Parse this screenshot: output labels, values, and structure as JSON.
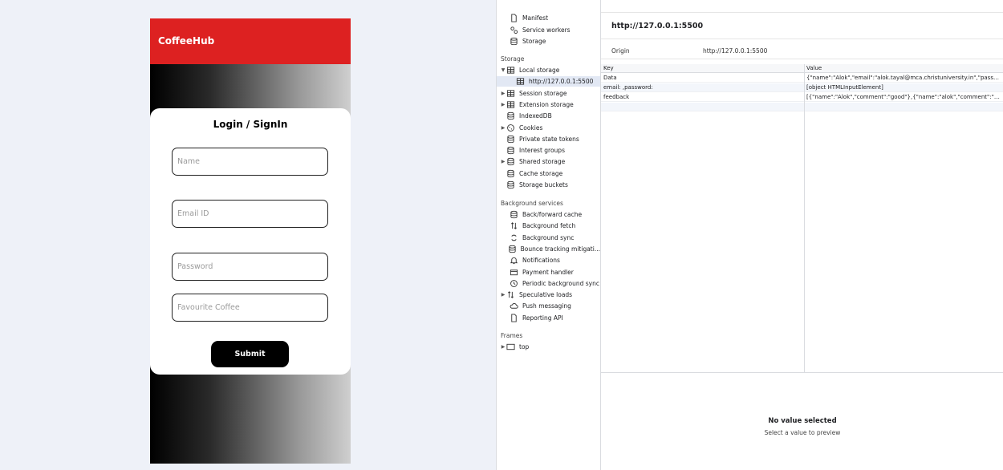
{
  "app": {
    "brand": "CoffeeHub",
    "form_title": "Login / SignIn",
    "fields": {
      "name_placeholder": "Name",
      "email_placeholder": "Email ID",
      "password_placeholder": "Password",
      "coffee_placeholder": "Favourite Coffee"
    },
    "submit_label": "Submit"
  },
  "devtools": {
    "sidebar": {
      "application": {
        "items": [
          {
            "label": "Manifest",
            "icon": "file-icon"
          },
          {
            "label": "Service workers",
            "icon": "gears-icon"
          },
          {
            "label": "Storage",
            "icon": "database-icon"
          }
        ]
      },
      "storage": {
        "heading": "Storage",
        "items": [
          {
            "label": "Local storage",
            "icon": "table-icon",
            "expand": "▼"
          },
          {
            "label": "http://127.0.0.1:5500",
            "icon": "table-icon",
            "selected": true
          },
          {
            "label": "Session storage",
            "icon": "table-icon",
            "expand": "▶"
          },
          {
            "label": "Extension storage",
            "icon": "table-icon",
            "expand": "▶"
          },
          {
            "label": "IndexedDB",
            "icon": "database-icon"
          },
          {
            "label": "Cookies",
            "icon": "cookie-icon",
            "expand": "▶"
          },
          {
            "label": "Private state tokens",
            "icon": "database-icon"
          },
          {
            "label": "Interest groups",
            "icon": "database-icon"
          },
          {
            "label": "Shared storage",
            "icon": "database-icon",
            "expand": "▶"
          },
          {
            "label": "Cache storage",
            "icon": "database-icon"
          },
          {
            "label": "Storage buckets",
            "icon": "database-icon"
          }
        ]
      },
      "background": {
        "heading": "Background services",
        "items": [
          {
            "label": "Back/forward cache",
            "icon": "database-icon"
          },
          {
            "label": "Background fetch",
            "icon": "updown-arrows-icon"
          },
          {
            "label": "Background sync",
            "icon": "sync-icon"
          },
          {
            "label": "Bounce tracking mitigati...",
            "icon": "database-icon"
          },
          {
            "label": "Notifications",
            "icon": "bell-icon"
          },
          {
            "label": "Payment handler",
            "icon": "card-icon"
          },
          {
            "label": "Periodic background sync",
            "icon": "clock-icon"
          },
          {
            "label": "Speculative loads",
            "icon": "updown-arrows-icon",
            "expand": "▶"
          },
          {
            "label": "Push messaging",
            "icon": "cloud-icon"
          },
          {
            "label": "Reporting API",
            "icon": "file-icon"
          }
        ]
      },
      "frames": {
        "heading": "Frames",
        "items": [
          {
            "label": "top",
            "icon": "frame-icon",
            "expand": "▶"
          }
        ]
      }
    },
    "main": {
      "origin_title": "http://127.0.0.1:5500",
      "origin_label": "Origin",
      "origin_value": "http://127.0.0.1:5500",
      "table": {
        "headers": [
          "Key",
          "Value"
        ],
        "rows": [
          {
            "key": "Data",
            "value": "{\"name\":\"Alok\",\"email\":\"alok.tayal@mca.christuniversity.in\",\"password\"..."
          },
          {
            "key": "email: ,password:",
            "value": "[object HTMLInputElement]"
          },
          {
            "key": "feedback",
            "value": "[{\"name\":\"Alok\",\"comment\":\"good\"},{\"name\":\"alok\",\"comment\":\"ok\"}]"
          }
        ]
      },
      "preview_title": "No value selected",
      "preview_subtitle": "Select a value to preview"
    }
  }
}
